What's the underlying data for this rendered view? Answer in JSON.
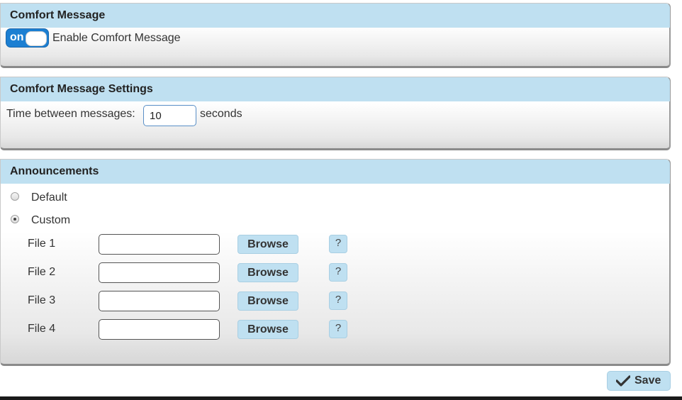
{
  "comfort_message": {
    "header": "Comfort Message",
    "toggle_state": "on",
    "enable_label": "Enable Comfort Message"
  },
  "settings": {
    "header": "Comfort Message Settings",
    "interval_label": "Time between messages:",
    "interval_value": "10",
    "interval_unit": "seconds"
  },
  "announcements": {
    "header": "Announcements",
    "options": [
      {
        "label": "Default",
        "selected": false
      },
      {
        "label": "Custom",
        "selected": true
      }
    ],
    "files": [
      {
        "label": "File 1",
        "value": "",
        "browse": "Browse",
        "help": "?"
      },
      {
        "label": "File 2",
        "value": "",
        "browse": "Browse",
        "help": "?"
      },
      {
        "label": "File 3",
        "value": "",
        "browse": "Browse",
        "help": "?"
      },
      {
        "label": "File 4",
        "value": "",
        "browse": "Browse",
        "help": "?"
      }
    ]
  },
  "save_label": "Save",
  "icons": {
    "save": "checkmark-icon"
  },
  "colors": {
    "header_bg": "#bfe0f1",
    "toggle_on": "#1c7fd2",
    "dark_bar": "#1a1a1a"
  }
}
